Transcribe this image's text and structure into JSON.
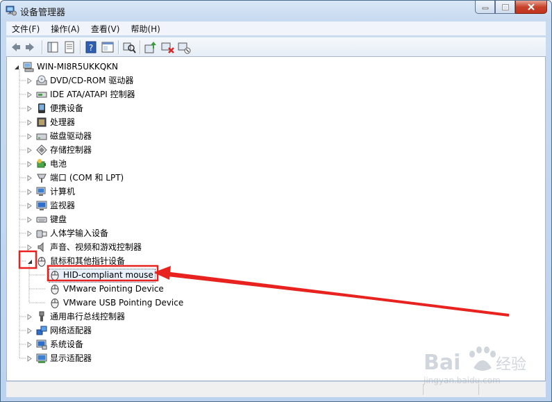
{
  "window": {
    "title": "设备管理器"
  },
  "menubar": [
    {
      "name": "menu-file",
      "label": "文件(F)"
    },
    {
      "name": "menu-action",
      "label": "操作(A)"
    },
    {
      "name": "menu-view",
      "label": "查看(V)"
    },
    {
      "name": "menu-help",
      "label": "帮助(H)"
    }
  ],
  "toolbar": [
    "back-icon",
    "forward-icon",
    "show-hide-tree-icon",
    "properties-icon",
    "help-icon",
    "view-pane-icon",
    "scan-hardware-icon",
    "update-driver-icon",
    "uninstall-icon",
    "disable-device-icon"
  ],
  "tree": {
    "root": "WIN-MI8R5UKKQKN",
    "categories": [
      {
        "label": "DVD/CD-ROM 驱动器",
        "icon": "dvd-drive-icon"
      },
      {
        "label": "IDE ATA/ATAPI 控制器",
        "icon": "ide-controller-icon"
      },
      {
        "label": "便携设备",
        "icon": "portable-device-icon"
      },
      {
        "label": "处理器",
        "icon": "processor-icon"
      },
      {
        "label": "磁盘驱动器",
        "icon": "disk-drive-icon"
      },
      {
        "label": "存储控制器",
        "icon": "storage-controller-icon"
      },
      {
        "label": "电池",
        "icon": "battery-icon"
      },
      {
        "label": "端口 (COM 和 LPT)",
        "icon": "port-icon"
      },
      {
        "label": "计算机",
        "icon": "computer-icon"
      },
      {
        "label": "监视器",
        "icon": "monitor-icon"
      },
      {
        "label": "键盘",
        "icon": "keyboard-icon"
      },
      {
        "label": "人体学输入设备",
        "icon": "hid-icon"
      },
      {
        "label": "声音、视频和游戏控制器",
        "icon": "sound-icon"
      },
      {
        "label": "鼠标和其他指针设备",
        "icon": "mouse-icon",
        "expanded": true,
        "children": [
          {
            "label": "HID-compliant mouse",
            "selected": true
          },
          {
            "label": "VMware Pointing Device"
          },
          {
            "label": "VMware USB Pointing Device"
          }
        ]
      },
      {
        "label": "通用串行总线控制器",
        "icon": "usb-icon"
      },
      {
        "label": "网络适配器",
        "icon": "network-adapter-icon"
      },
      {
        "label": "系统设备",
        "icon": "system-device-icon"
      },
      {
        "label": "显示适配器",
        "icon": "display-adapter-icon"
      }
    ]
  },
  "annotation_color": "#e8231f",
  "accent": "#3399ff"
}
